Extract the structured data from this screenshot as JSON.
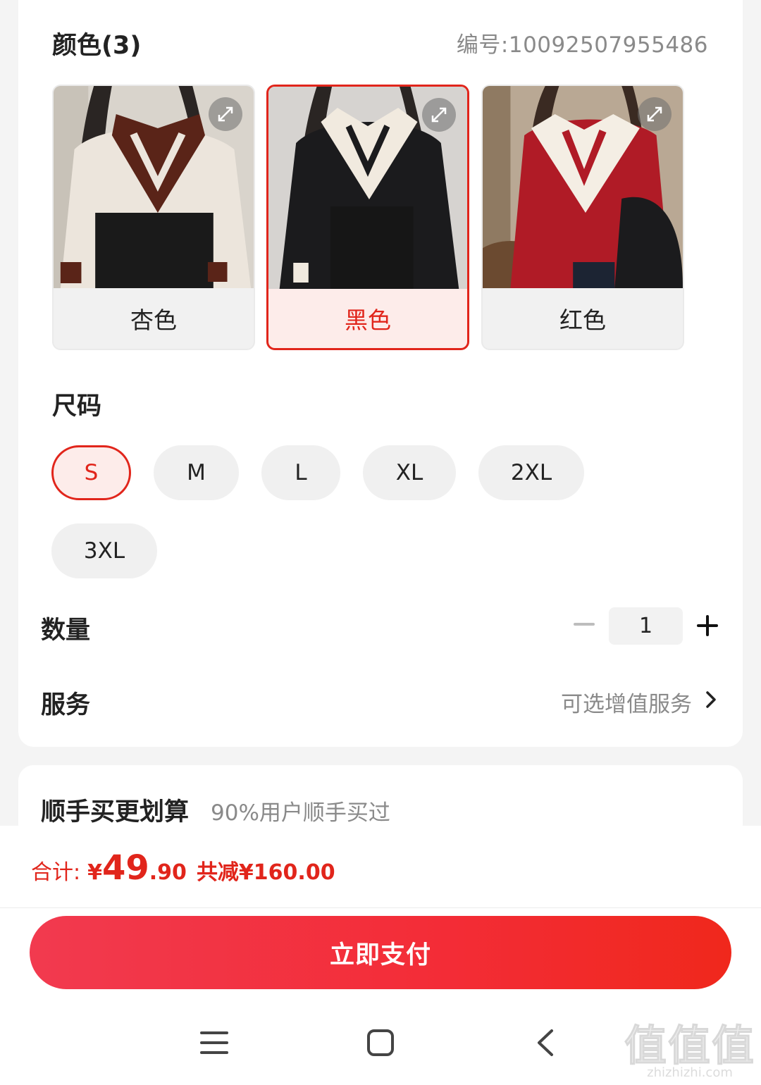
{
  "color_section": {
    "title": "颜色(3)",
    "sku_code": "编号:10092507955486",
    "options": [
      {
        "label": "杏色",
        "selected": false,
        "top_color": "#ece5dc",
        "accent_color": "#5a2418"
      },
      {
        "label": "黑色",
        "selected": true,
        "top_color": "#1b1b1d",
        "accent_color": "#f1eadf"
      },
      {
        "label": "红色",
        "selected": false,
        "top_color": "#b01b26",
        "accent_color": "#f4eee4"
      }
    ]
  },
  "size_section": {
    "title": "尺码",
    "options": [
      {
        "label": "S",
        "selected": true
      },
      {
        "label": "M",
        "selected": false
      },
      {
        "label": "L",
        "selected": false
      },
      {
        "label": "XL",
        "selected": false
      },
      {
        "label": "2XL",
        "selected": false
      },
      {
        "label": "3XL",
        "selected": false
      }
    ]
  },
  "quantity": {
    "label": "数量",
    "value": "1"
  },
  "service": {
    "label": "服务",
    "value": "可选增值服务"
  },
  "bundle": {
    "title": "顺手买更划算",
    "subtitle": "90%用户顺手买过"
  },
  "total": {
    "label": "合计:",
    "currency": "¥",
    "price_int": "49",
    "price_dec": ".90",
    "discount": "共减¥160.00"
  },
  "pay_button": "立即支付",
  "watermark": {
    "big": "值值值",
    "small": "zhizhizhi.com"
  },
  "colors": {
    "accent": "#e1251b",
    "selected_bg": "#fdecea",
    "chip_bg": "#f0f0f0"
  }
}
